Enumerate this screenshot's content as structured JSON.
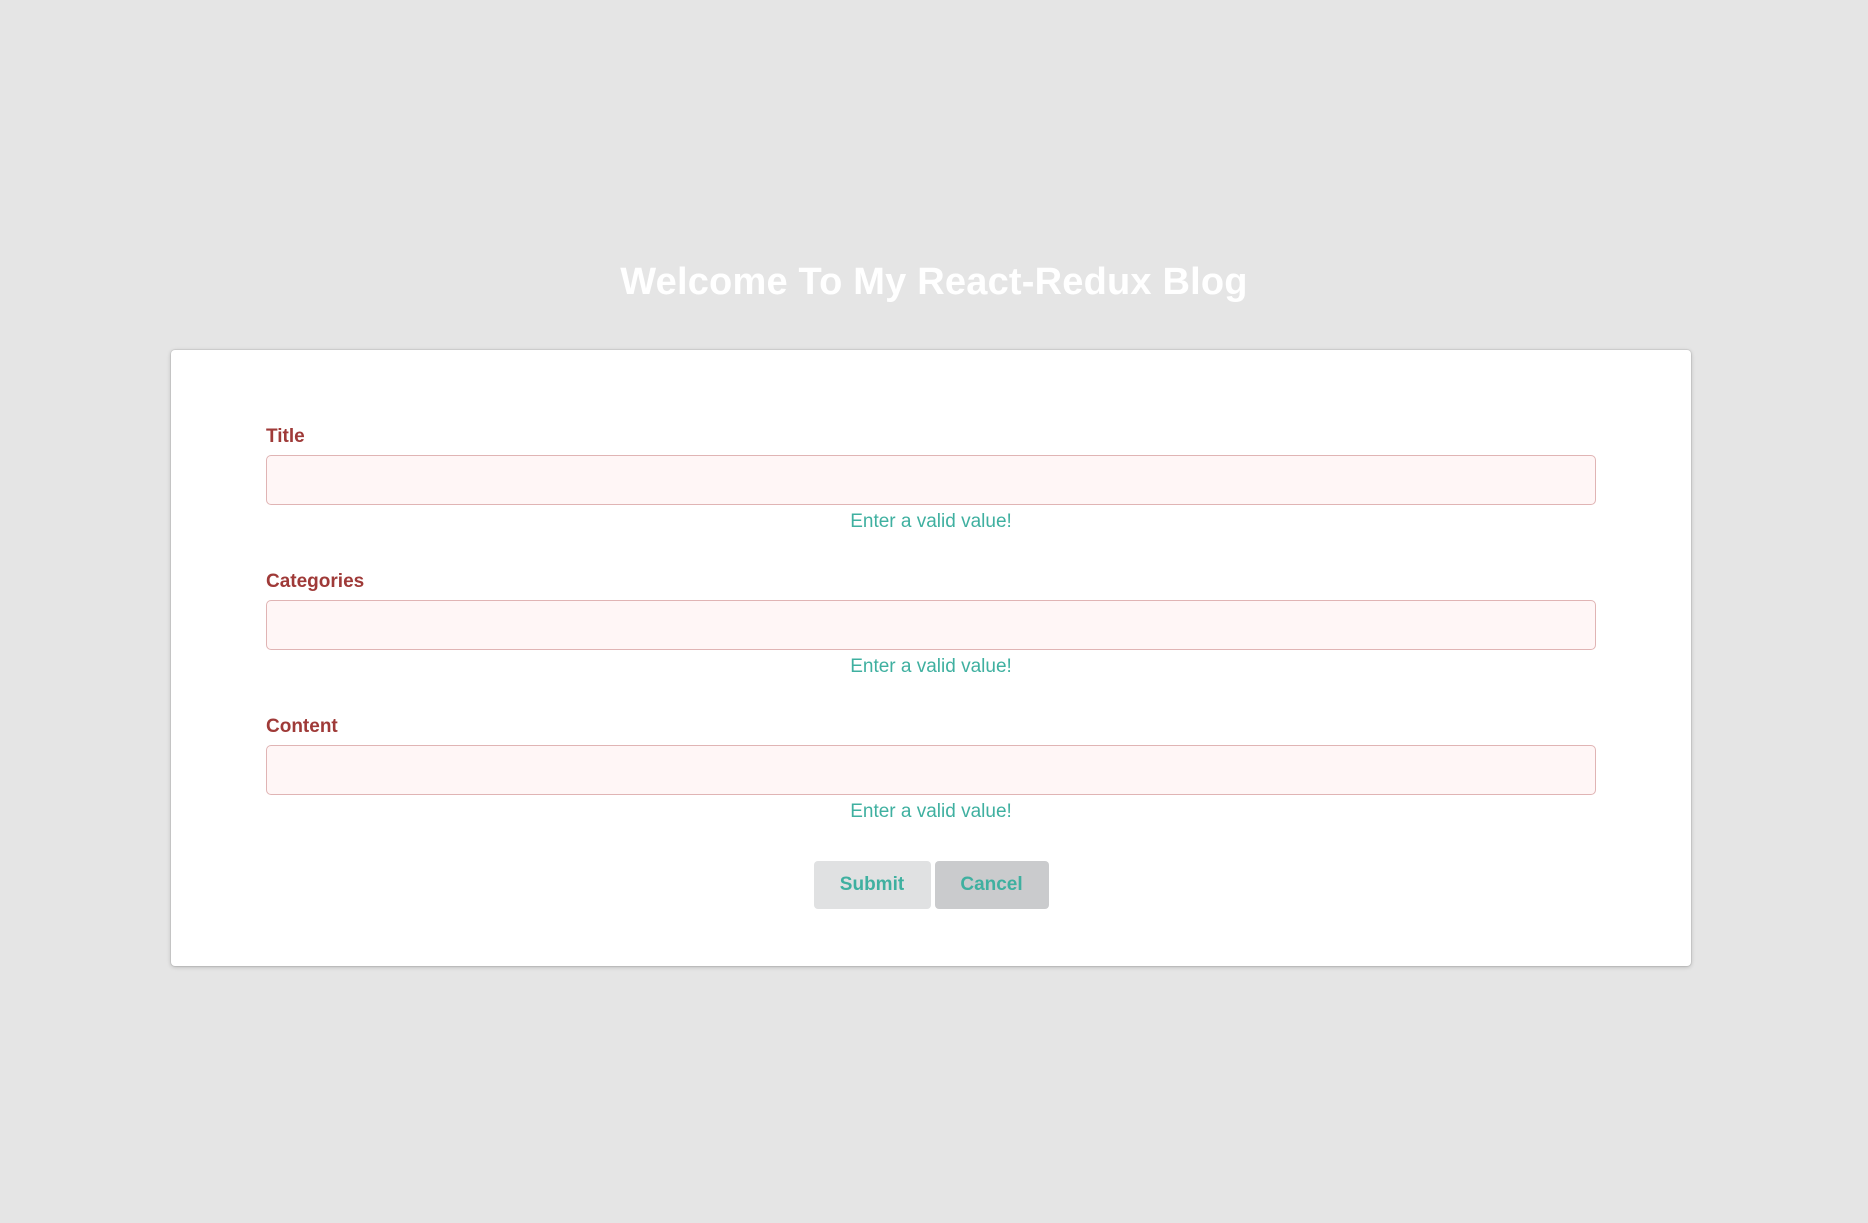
{
  "header": {
    "title": "Welcome To My React-Redux Blog"
  },
  "form": {
    "fields": [
      {
        "label": "Title",
        "value": "",
        "error": "Enter a valid value!"
      },
      {
        "label": "Categories",
        "value": "",
        "error": "Enter a valid value!"
      },
      {
        "label": "Content",
        "value": "",
        "error": "Enter a valid value!"
      }
    ],
    "submit_label": "Submit",
    "cancel_label": "Cancel"
  },
  "colors": {
    "background": "#e5e5e5",
    "error_label": "#9f3a38",
    "error_input_bg": "#fff6f6",
    "error_input_border": "#e0b4b4",
    "accent_text": "#3fb0a0",
    "submit_bg": "#e0e1e2",
    "cancel_bg": "#cacbcd"
  }
}
